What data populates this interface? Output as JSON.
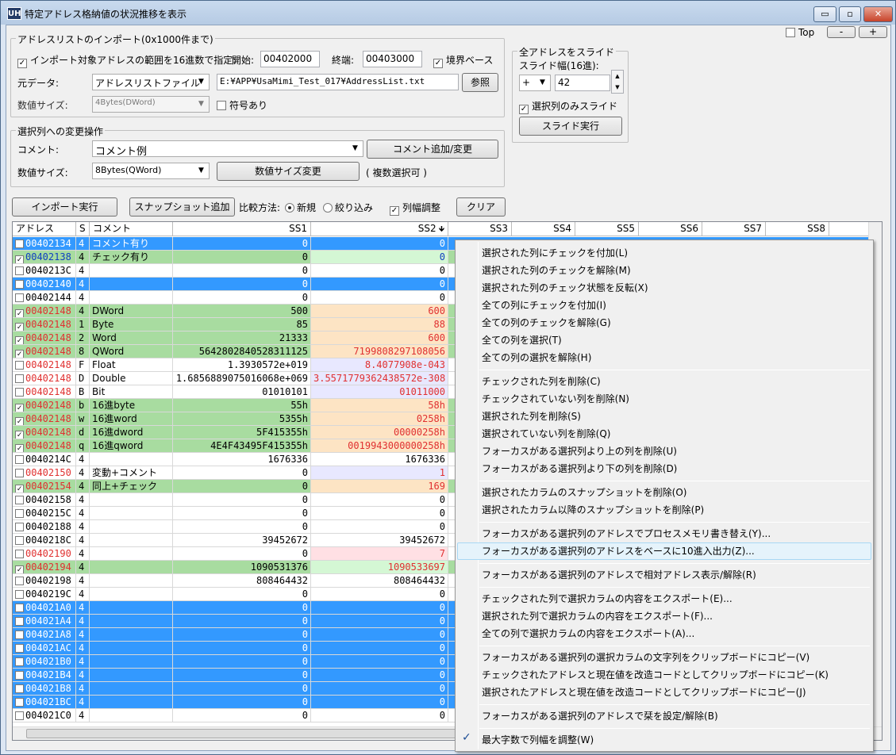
{
  "window": {
    "icon_text": "UH",
    "title": "特定アドレス格納値の状況推移を表示",
    "minimize": "▭",
    "maximize": "▫",
    "close": "✕"
  },
  "top_controls": {
    "top_label": "Top",
    "minus": "-",
    "plus": "+"
  },
  "import": {
    "group_title": "アドレスリストのインポート(0x1000件まで)",
    "range_label": "インポート対象アドレスの範囲を16進数で指定:",
    "start_label": "開始:",
    "start_value": "00402000",
    "end_label": "終端:",
    "end_value": "00403000",
    "boundary_label": "境界ベース",
    "source_label": "元データ:",
    "source_value": "アドレスリストファイル",
    "path_value": "E:¥APP¥UsaMimi_Test_017¥AddressList.txt",
    "browse_label": "参照",
    "size_label": "数値サイズ:",
    "size_value": "4Bytes(DWord)",
    "signed_label": "符号あり"
  },
  "change": {
    "group_title": "選択列への変更操作",
    "comment_label": "コメント:",
    "comment_value": "コメント例",
    "add_comment_button": "コメント追加/変更",
    "size_label": "数値サイズ:",
    "size_value": "8Bytes(QWord)",
    "change_size_button": "数値サイズ変更",
    "multi_note": "( 複数選択可 )"
  },
  "slide": {
    "group_title": "全アドレスをスライド",
    "width_label": "スライド幅(16進):",
    "sign_value": "+",
    "width_value": "42",
    "selected_only_label": "選択列のみスライド",
    "execute_button": "スライド実行"
  },
  "toolbar": {
    "import_button": "インポート実行",
    "snapshot_button": "スナップショット追加",
    "compare_label": "比較方法:",
    "new_label": "新規",
    "filter_label": "絞り込み",
    "colwidth_label": "列幅調整",
    "clear_button": "クリア"
  },
  "grid": {
    "headers": [
      "アドレス",
      "S",
      "コメント",
      "SS1",
      "SS2",
      "SS3",
      "SS4",
      "SS5",
      "SS6",
      "SS7",
      "SS8"
    ],
    "sort_arrow": "🡻",
    "rows": [
      {
        "addr": "00402134",
        "s": "4",
        "comment": "コメント有り",
        "ss1": "0",
        "ss2": "0",
        "checked": false,
        "style": "sel",
        "addr_color": "#ffffff"
      },
      {
        "addr": "00402138",
        "s": "4",
        "comment": "チェック有り",
        "ss1": "0",
        "ss2": "0",
        "checked": true,
        "style": "green",
        "addr_color": "#1040c0",
        "ss2_bg": "#d4f7d4",
        "ss2_color": "#1040c0"
      },
      {
        "addr": "0040213C",
        "s": "4",
        "comment": "",
        "ss1": "0",
        "ss2": "0",
        "checked": false,
        "style": "plain",
        "addr_color": "#000000"
      },
      {
        "addr": "00402140",
        "s": "4",
        "comment": "",
        "ss1": "0",
        "ss2": "0",
        "checked": false,
        "style": "sel",
        "addr_color": "#ffffff"
      },
      {
        "addr": "00402144",
        "s": "4",
        "comment": "",
        "ss1": "0",
        "ss2": "0",
        "checked": false,
        "style": "plain",
        "addr_color": "#000000"
      },
      {
        "addr": "00402148",
        "s": "4",
        "comment": "DWord",
        "ss1": "500",
        "ss2": "600",
        "checked": true,
        "style": "green",
        "addr_color": "#e03030",
        "ss2_bg": "#fde4c4",
        "ss2_color": "#e03030"
      },
      {
        "addr": "00402148",
        "s": "1",
        "comment": "Byte",
        "ss1": "85",
        "ss2": "88",
        "checked": true,
        "style": "green",
        "addr_color": "#e03030",
        "ss2_bg": "#fde4c4",
        "ss2_color": "#e03030"
      },
      {
        "addr": "00402148",
        "s": "2",
        "comment": "Word",
        "ss1": "21333",
        "ss2": "600",
        "checked": true,
        "style": "green",
        "addr_color": "#e03030",
        "ss2_bg": "#fde4c4",
        "ss2_color": "#e03030"
      },
      {
        "addr": "00402148",
        "s": "8",
        "comment": "QWord",
        "ss1": "5642802840528311125",
        "ss2": "7199808297108056",
        "checked": true,
        "style": "green",
        "addr_color": "#e03030",
        "ss2_bg": "#fde4c4",
        "ss2_color": "#e03030"
      },
      {
        "addr": "00402148",
        "s": "F",
        "comment": "Float",
        "ss1": "1.3930572e+019",
        "ss2": "8.4077908e-043",
        "checked": false,
        "style": "plain",
        "addr_color": "#e03030",
        "ss2_bg": "#e8e8ff",
        "ss2_color": "#e03030"
      },
      {
        "addr": "00402148",
        "s": "D",
        "comment": "Double",
        "ss1": "1.6856889075016068e+069",
        "ss2": "3.5571779362438572e-308",
        "checked": false,
        "style": "plain",
        "addr_color": "#e03030",
        "ss2_bg": "#e8e8ff",
        "ss2_color": "#e03030"
      },
      {
        "addr": "00402148",
        "s": "B",
        "comment": "Bit",
        "ss1": "01010101",
        "ss2": "01011000",
        "checked": false,
        "style": "plain",
        "addr_color": "#e03030",
        "ss2_bg": "#e8e8ff",
        "ss2_color": "#e03030"
      },
      {
        "addr": "00402148",
        "s": "b",
        "comment": "16進byte",
        "ss1": "55h",
        "ss2": "58h",
        "checked": true,
        "style": "green",
        "addr_color": "#e03030",
        "ss2_bg": "#fde4c4",
        "ss2_color": "#e03030"
      },
      {
        "addr": "00402148",
        "s": "w",
        "comment": "16進word",
        "ss1": "5355h",
        "ss2": "0258h",
        "checked": true,
        "style": "green",
        "addr_color": "#e03030",
        "ss2_bg": "#fde4c4",
        "ss2_color": "#e03030"
      },
      {
        "addr": "00402148",
        "s": "d",
        "comment": "16進dword",
        "ss1": "5F415355h",
        "ss2": "00000258h",
        "checked": true,
        "style": "green",
        "addr_color": "#e03030",
        "ss2_bg": "#fde4c4",
        "ss2_color": "#e03030"
      },
      {
        "addr": "00402148",
        "s": "q",
        "comment": "16進qword",
        "ss1": "4E4F43495F415355h",
        "ss2": "0019943000000258h",
        "checked": true,
        "style": "green",
        "addr_color": "#e03030",
        "ss2_bg": "#fde4c4",
        "ss2_color": "#e03030"
      },
      {
        "addr": "0040214C",
        "s": "4",
        "comment": "",
        "ss1": "1676336",
        "ss2": "1676336",
        "checked": false,
        "style": "plain",
        "addr_color": "#000000"
      },
      {
        "addr": "00402150",
        "s": "4",
        "comment": "変動+コメント",
        "ss1": "0",
        "ss2": "1",
        "checked": false,
        "style": "plain",
        "addr_color": "#e03030",
        "ss2_bg": "#e8e8ff",
        "ss2_color": "#e03030"
      },
      {
        "addr": "00402154",
        "s": "4",
        "comment": "同上+チェック",
        "ss1": "0",
        "ss2": "169",
        "checked": true,
        "style": "green",
        "addr_color": "#e03030",
        "ss2_bg": "#fde4c4",
        "ss2_color": "#e03030"
      },
      {
        "addr": "00402158",
        "s": "4",
        "comment": "",
        "ss1": "0",
        "ss2": "0",
        "checked": false,
        "style": "plain",
        "addr_color": "#000000"
      },
      {
        "addr": "0040215C",
        "s": "4",
        "comment": "",
        "ss1": "0",
        "ss2": "0",
        "checked": false,
        "style": "plain",
        "addr_color": "#000000"
      },
      {
        "addr": "00402188",
        "s": "4",
        "comment": "",
        "ss1": "0",
        "ss2": "0",
        "checked": false,
        "style": "plain",
        "addr_color": "#000000"
      },
      {
        "addr": "0040218C",
        "s": "4",
        "comment": "",
        "ss1": "39452672",
        "ss2": "39452672",
        "checked": false,
        "style": "plain",
        "addr_color": "#000000"
      },
      {
        "addr": "00402190",
        "s": "4",
        "comment": "",
        "ss1": "0",
        "ss2": "7",
        "checked": false,
        "style": "plain",
        "addr_color": "#e03030",
        "ss2_bg": "#ffe0e4",
        "ss2_color": "#e03030"
      },
      {
        "addr": "00402194",
        "s": "4",
        "comment": "",
        "ss1": "1090531376",
        "ss2": "1090533697",
        "checked": true,
        "style": "green",
        "addr_color": "#e03030",
        "ss2_bg": "#d4f7d4",
        "ss2_color": "#e03030"
      },
      {
        "addr": "00402198",
        "s": "4",
        "comment": "",
        "ss1": "808464432",
        "ss2": "808464432",
        "checked": false,
        "style": "plain",
        "addr_color": "#000000"
      },
      {
        "addr": "0040219C",
        "s": "4",
        "comment": "",
        "ss1": "0",
        "ss2": "0",
        "checked": false,
        "style": "plain",
        "addr_color": "#000000"
      },
      {
        "addr": "004021A0",
        "s": "4",
        "comment": "",
        "ss1": "0",
        "ss2": "0",
        "checked": false,
        "style": "sel",
        "addr_color": "#ffffff"
      },
      {
        "addr": "004021A4",
        "s": "4",
        "comment": "",
        "ss1": "0",
        "ss2": "0",
        "checked": false,
        "style": "sel",
        "addr_color": "#ffffff"
      },
      {
        "addr": "004021A8",
        "s": "4",
        "comment": "",
        "ss1": "0",
        "ss2": "0",
        "checked": false,
        "style": "sel",
        "addr_color": "#ffffff"
      },
      {
        "addr": "004021AC",
        "s": "4",
        "comment": "",
        "ss1": "0",
        "ss2": "0",
        "checked": false,
        "style": "sel",
        "addr_color": "#ffffff"
      },
      {
        "addr": "004021B0",
        "s": "4",
        "comment": "",
        "ss1": "0",
        "ss2": "0",
        "checked": false,
        "style": "sel",
        "addr_color": "#ffffff"
      },
      {
        "addr": "004021B4",
        "s": "4",
        "comment": "",
        "ss1": "0",
        "ss2": "0",
        "checked": false,
        "style": "sel",
        "addr_color": "#ffffff"
      },
      {
        "addr": "004021B8",
        "s": "4",
        "comment": "",
        "ss1": "0",
        "ss2": "0",
        "checked": false,
        "style": "sel",
        "addr_color": "#ffffff"
      },
      {
        "addr": "004021BC",
        "s": "4",
        "comment": "",
        "ss1": "0",
        "ss2": "0",
        "checked": false,
        "style": "sel",
        "addr_color": "#ffffff"
      },
      {
        "addr": "004021C0",
        "s": "4",
        "comment": "",
        "ss1": "0",
        "ss2": "0",
        "checked": false,
        "style": "plain",
        "addr_color": "#000000"
      }
    ]
  },
  "colors": {
    "selection": "#3399ff",
    "green": "#a8dca0",
    "orange": "#fde4c4"
  },
  "context_menu": {
    "groups": [
      [
        "選択された列にチェックを付加(L)",
        "選択された列のチェックを解除(M)",
        "選択された列のチェック状態を反転(X)",
        "全ての列にチェックを付加(I)",
        "全ての列のチェックを解除(G)",
        "全ての列を選択(T)",
        "全ての列の選択を解除(H)"
      ],
      [
        "チェックされた列を削除(C)",
        "チェックされていない列を削除(N)",
        "選択された列を削除(S)",
        "選択されていない列を削除(Q)",
        "フォーカスがある選択列より上の列を削除(U)",
        "フォーカスがある選択列より下の列を削除(D)"
      ],
      [
        "選択されたカラムのスナップショットを削除(O)",
        "選択されたカラム以降のスナップショットを削除(P)"
      ],
      [
        "フォーカスがある選択列のアドレスでプロセスメモリ書き替え(Y)...",
        "フォーカスがある選択列のアドレスをベースに10進入出力(Z)..."
      ],
      [
        "フォーカスがある選択列のアドレスで相対アドレス表示/解除(R)"
      ],
      [
        "チェックされた列で選択カラムの内容をエクスポート(E)...",
        "選択された列で選択カラムの内容をエクスポート(F)...",
        "全ての列で選択カラムの内容をエクスポート(A)..."
      ],
      [
        "フォーカスがある選択列の選択カラムの文字列をクリップボードにコピー(V)",
        "チェックされたアドレスと現在値を改造コードとしてクリップボードにコピー(K)",
        "選択されたアドレスと現在値を改造コードとしてクリップボードにコピー(J)"
      ],
      [
        "フォーカスがある選択列のアドレスで栞を設定/解除(B)"
      ],
      [
        "最大字数で列幅を調整(W)"
      ]
    ],
    "checked_mark": "✓",
    "highlighted_item": "フォーカスがある選択列のアドレスをベースに10進入出力(Z)..."
  }
}
